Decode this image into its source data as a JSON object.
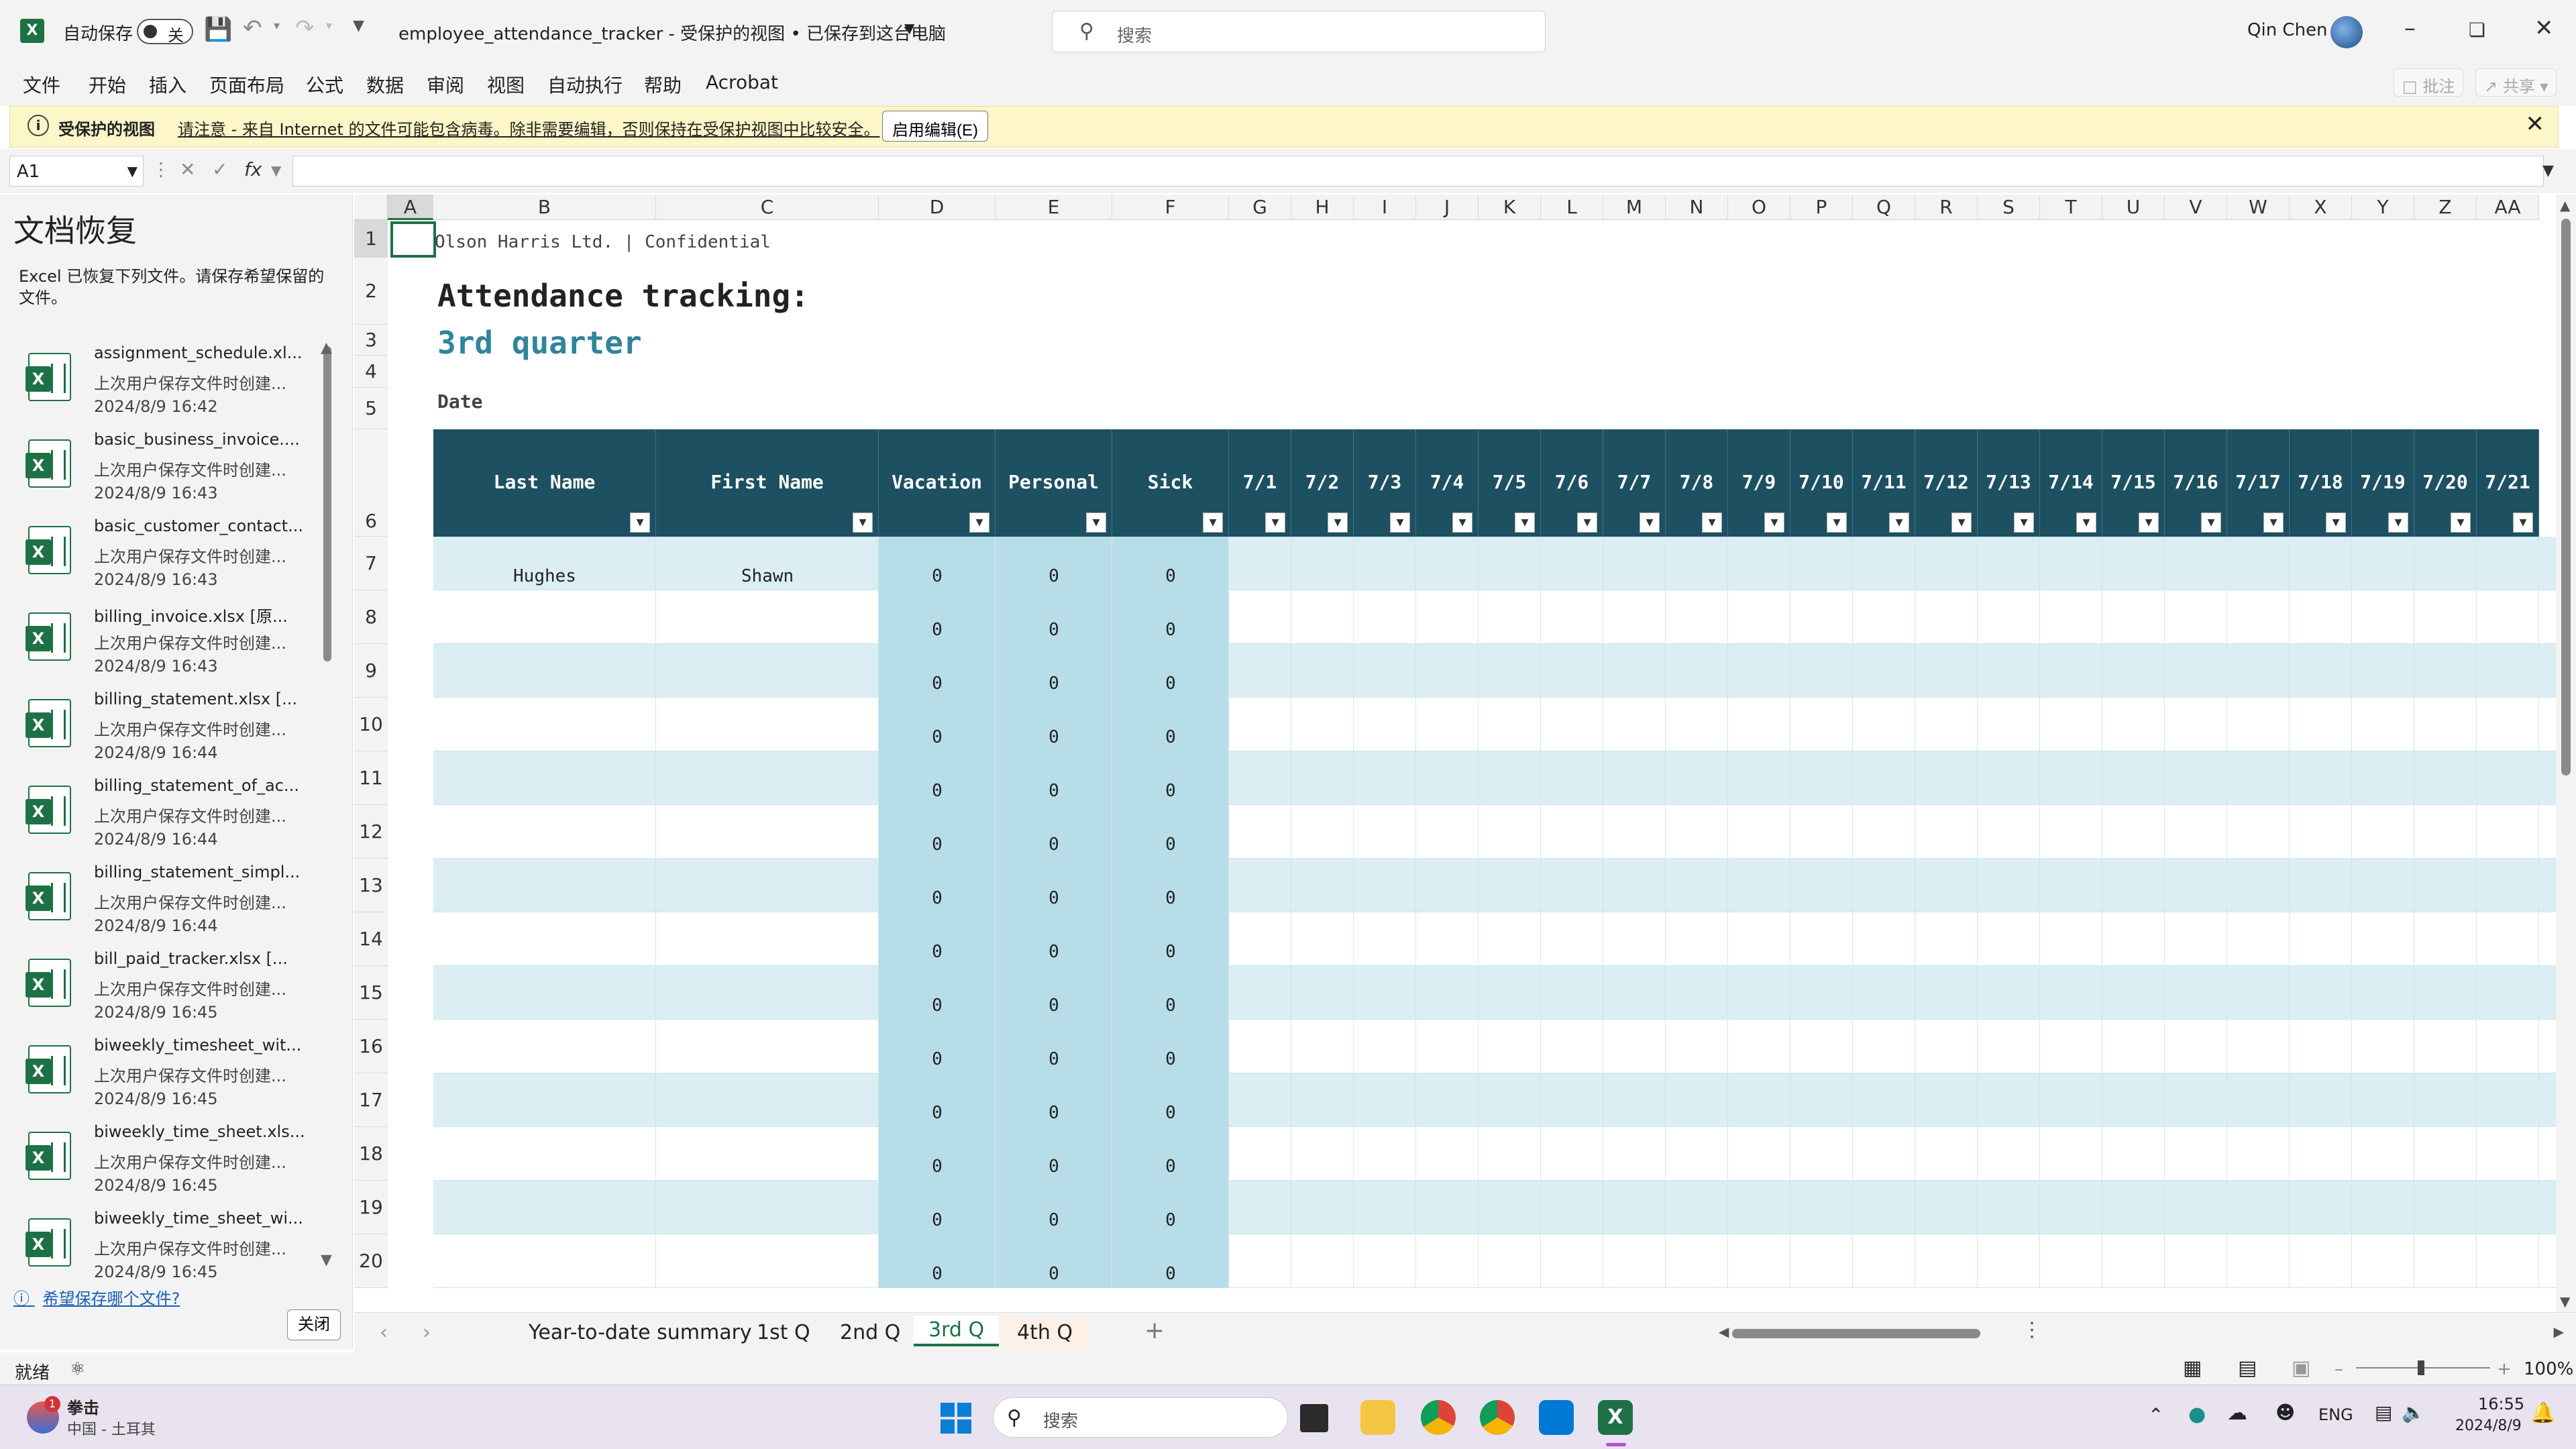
{
  "titlebar": {
    "autosave_label": "自动保存",
    "autosave_state": "关",
    "title": "employee_attendance_tracker  -  受保护的视图 • 已保存到这台电脑",
    "search_placeholder": "搜索",
    "user_name": "Qin Chen"
  },
  "menu": {
    "items": [
      "文件",
      "开始",
      "插入",
      "页面布局",
      "公式",
      "数据",
      "审阅",
      "视图",
      "自动执行",
      "帮助",
      "Acrobat"
    ],
    "comments": "批注",
    "share": "共享"
  },
  "protected_bar": {
    "bold": "受保护的视图",
    "message": "请注意 - 来自 Internet 的文件可能包含病毒。除非需要编辑，否则保持在受保护视图中比较安全。",
    "enable_button": "启用编辑(E)"
  },
  "formula_bar": {
    "name_box": "A1",
    "fx": "fx"
  },
  "recovery": {
    "title": "文档恢复",
    "description": "Excel 已恢复下列文件。请保存希望保留的文件。",
    "items": [
      {
        "name": "assignment_schedule.xl...",
        "status": "上次用户保存文件时创建...",
        "date": "2024/8/9 16:42"
      },
      {
        "name": "basic_business_invoice....",
        "status": "上次用户保存文件时创建...",
        "date": "2024/8/9 16:43"
      },
      {
        "name": "basic_customer_contact...",
        "status": "上次用户保存文件时创建...",
        "date": "2024/8/9 16:43"
      },
      {
        "name": "billing_invoice.xlsx  [原...",
        "status": "上次用户保存文件时创建...",
        "date": "2024/8/9 16:43"
      },
      {
        "name": "billing_statement.xlsx  [...",
        "status": "上次用户保存文件时创建...",
        "date": "2024/8/9 16:44"
      },
      {
        "name": "billing_statement_of_ac...",
        "status": "上次用户保存文件时创建...",
        "date": "2024/8/9 16:44"
      },
      {
        "name": "billing_statement_simpl...",
        "status": "上次用户保存文件时创建...",
        "date": "2024/8/9 16:44"
      },
      {
        "name": "bill_paid_tracker.xlsx  [...",
        "status": "上次用户保存文件时创建...",
        "date": "2024/8/9 16:45"
      },
      {
        "name": "biweekly_timesheet_wit...",
        "status": "上次用户保存文件时创建...",
        "date": "2024/8/9 16:45"
      },
      {
        "name": "biweekly_time_sheet.xls...",
        "status": "上次用户保存文件时创建...",
        "date": "2024/8/9 16:45"
      },
      {
        "name": "biweekly_time_sheet_wi...",
        "status": "上次用户保存文件时创建...",
        "date": "2024/8/9 16:45"
      }
    ],
    "link": "希望保存哪个文件?",
    "close": "关闭"
  },
  "sheet": {
    "columns": [
      "A",
      "B",
      "C",
      "D",
      "E",
      "F",
      "G",
      "H",
      "I",
      "J",
      "K",
      "L",
      "M",
      "N",
      "O",
      "P",
      "Q",
      "R",
      "S",
      "T",
      "U",
      "V",
      "W",
      "X",
      "Y",
      "Z",
      "AA"
    ],
    "rows": [
      "1",
      "2",
      "3",
      "4",
      "5",
      "6",
      "7",
      "8",
      "9",
      "10",
      "11",
      "12",
      "13",
      "14",
      "15",
      "16",
      "17",
      "18",
      "19",
      "20"
    ],
    "company": "Olson Harris Ltd.  |  Confidential",
    "heading": "Attendance tracking:",
    "subheading": "3rd quarter",
    "date_label": "Date",
    "headers": [
      "Last Name",
      "First Name",
      "Vacation",
      "Personal",
      "Sick",
      "7/1",
      "7/2",
      "7/3",
      "7/4",
      "7/5",
      "7/6",
      "7/7",
      "7/8",
      "7/9",
      "7/10",
      "7/11",
      "7/12",
      "7/13",
      "7/14",
      "7/15",
      "7/16",
      "7/17",
      "7/18",
      "7/19",
      "7/20",
      "7/21"
    ],
    "first_row": {
      "last": "Hughes",
      "first": "Shawn"
    },
    "zero": "0",
    "colors": {
      "header": "#1d5061",
      "band": "#daeef3",
      "total_col": "#b7dde8",
      "accent": "#31849b"
    }
  },
  "tabs": {
    "items": [
      "Year-to-date summary",
      "1st Q",
      "2nd Q",
      "3rd Q",
      "4th Q"
    ],
    "active": "3rd Q",
    "add": "+"
  },
  "status": {
    "ready": "就绪",
    "zoom": "100%"
  },
  "taskbar": {
    "weather_title": "拳击",
    "weather_sub": "中国 - 土耳其",
    "search_placeholder": "搜索",
    "lang": "ENG",
    "time": "16:55",
    "date": "2024/8/9"
  }
}
